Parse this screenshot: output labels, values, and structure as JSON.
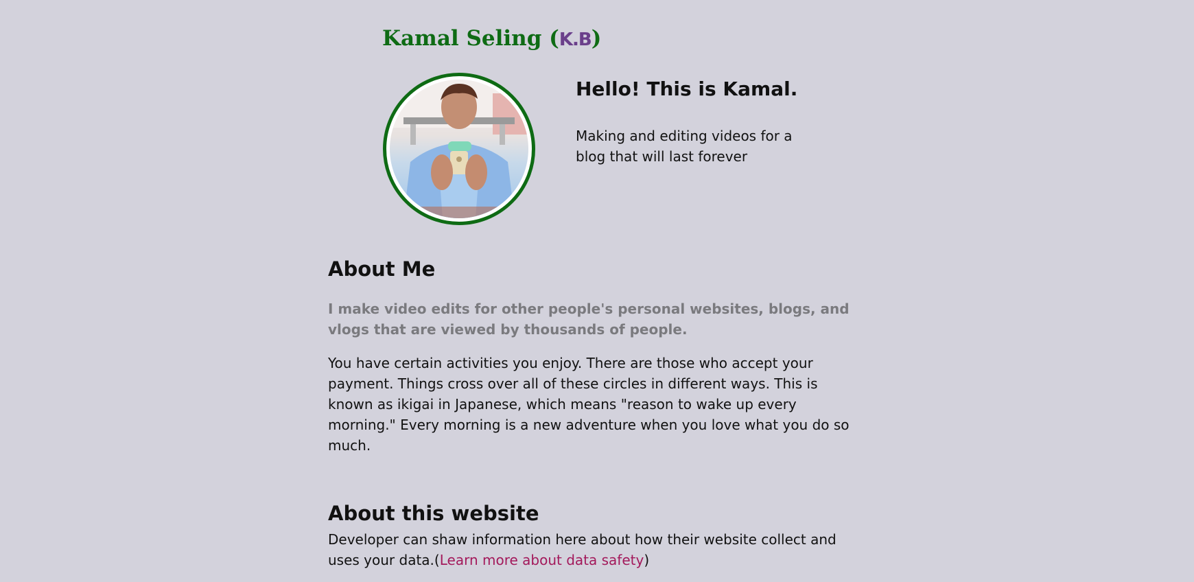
{
  "header": {
    "name": "Kamal Seling",
    "open_paren": "(",
    "badge": "K.B",
    "close_paren": ")"
  },
  "hero": {
    "avatar_alt": "profile photo",
    "greeting": "Hello! This is Kamal.",
    "tagline": "Making and editing videos for a blog that will last forever"
  },
  "about": {
    "heading": "About Me",
    "lead": "I make video edits for other people's personal websites, blogs, and vlogs that are viewed by thousands of people.",
    "body": "You have certain activities you enjoy. There are those who accept your payment. Things cross over all of these circles in different ways. This is known as ikigai in Japanese, which means \"reason to wake up every morning.\" Every morning is a new adventure when you love what you do so much."
  },
  "website": {
    "heading": "About this website",
    "text_before": "Developer can shaw information here about how their website collect and uses your data.(",
    "link_label": "Learn more about data safety",
    "text_after": ")"
  },
  "colors": {
    "background": "#d3d2dc",
    "accent_green": "#0e6b14",
    "link": "#a3195b",
    "muted": "#7a7a7e"
  }
}
